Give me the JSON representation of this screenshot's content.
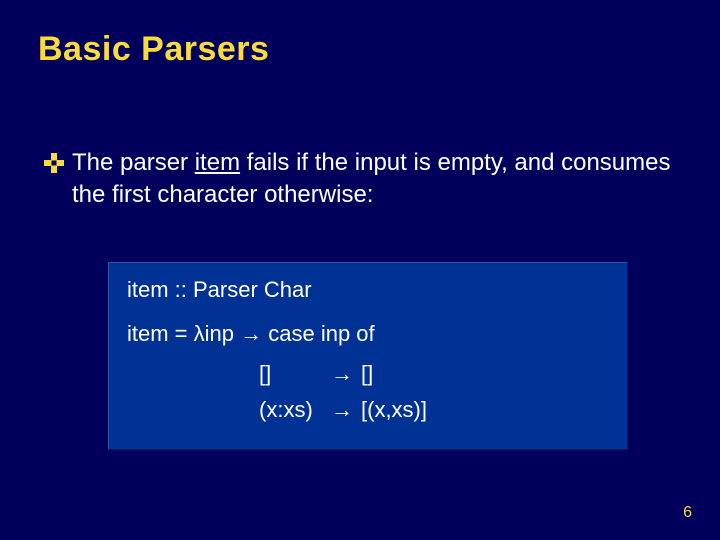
{
  "title": "Basic Parsers",
  "bullet": {
    "pre": "The parser ",
    "underlined": "item",
    "post": " fails if the input is empty, and consumes the first character otherwise:"
  },
  "code": {
    "line1": "item :: Parser Char",
    "line2_pre": "item  = ",
    "line2_lambda": "λ",
    "line2_mid": "inp ",
    "line2_arrow": "→",
    "line2_post": " case inp of",
    "case1_lhs": "[]",
    "case1_arrow": "→",
    "case1_rhs": " []",
    "case2_lhs": "(x:xs)",
    "case2_arrow": "→",
    "case2_rhs": " [(x,xs)]"
  },
  "page_number": "6"
}
